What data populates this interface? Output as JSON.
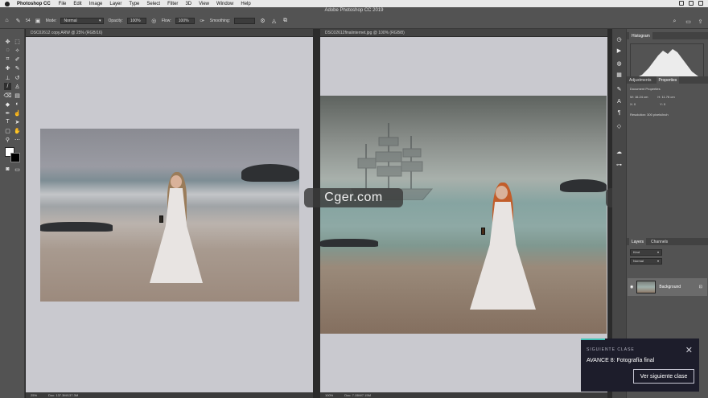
{
  "menubar": {
    "app": "Photoshop CC",
    "items": [
      "File",
      "Edit",
      "Image",
      "Layer",
      "Type",
      "Select",
      "Filter",
      "3D",
      "View",
      "Window",
      "Help"
    ]
  },
  "window_title": "Adobe Photoshop CC 2019",
  "options": {
    "brush_size": "54",
    "mode_label": "Mode:",
    "mode_value": "Normal",
    "opacity_label": "Opacity:",
    "opacity_value": "100%",
    "flow_label": "Flow:",
    "flow_value": "100%",
    "smoothing_label": "Smoothing:"
  },
  "docs": [
    {
      "tab": "DSC02612 copy.ARW @ 25% (RGB/16)",
      "zoom": "25%",
      "info": "Doc: 137.3M/137.3M"
    },
    {
      "tab": "DSC02612finalinternet.jpg @ 100% (RGB/8)",
      "zoom": "100%",
      "info": "Doc: 7.15M/7.15M"
    }
  ],
  "watermark": "Cger.com",
  "histogram": {
    "tab": "Histogram"
  },
  "properties": {
    "tabs": [
      "Adjustments",
      "Properties"
    ],
    "section": "Document Properties",
    "w_label": "W:",
    "w_value": "16.24 cm",
    "h_label": "H:",
    "h_value": "11.76 cm",
    "x_label": "X:",
    "x_value": "0",
    "y_label": "Y:",
    "y_value": "0",
    "resolution": "Resolution: 300 pixels/inch"
  },
  "layers": {
    "tabs": [
      "Layers",
      "Channels"
    ],
    "kind": "Kind",
    "blend": "Normal",
    "layer_name": "Background"
  },
  "popup": {
    "kicker": "SIGUIENTE CLASE",
    "title": "AVANCE 8: Fotografía final",
    "button": "Ver siguiente clase"
  },
  "colors": {
    "popup_bg": "#1d1d2b",
    "popup_accent": "#3ec4b7",
    "canvas": "#c9c9cf"
  }
}
